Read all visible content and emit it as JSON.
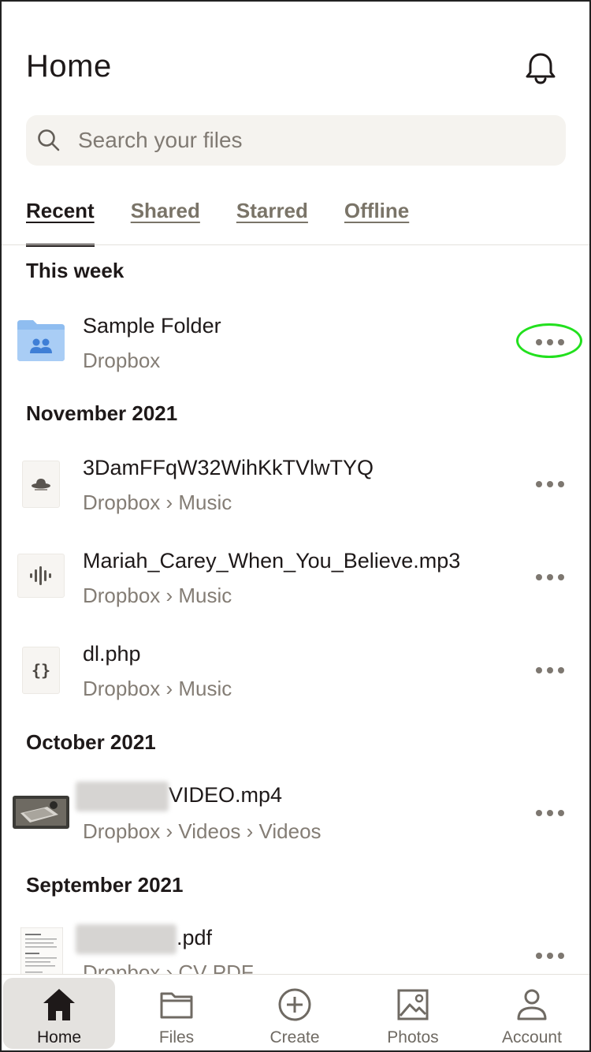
{
  "header": {
    "title": "Home",
    "notifications_icon": "bell-icon"
  },
  "search": {
    "placeholder": "Search your files",
    "icon": "search-icon"
  },
  "tabs": [
    {
      "label": "Recent",
      "active": true
    },
    {
      "label": "Shared",
      "active": false
    },
    {
      "label": "Starred",
      "active": false
    },
    {
      "label": "Offline",
      "active": false
    }
  ],
  "sections": {
    "this_week": "This week",
    "november": "November 2021",
    "october": "October 2021",
    "september": "September 2021"
  },
  "files": {
    "sample_folder": {
      "name": "Sample Folder",
      "path": "Dropbox",
      "icon": "shared-folder-icon"
    },
    "file_3dam": {
      "name": "3DamFFqW32WihKkTVlwTYQ",
      "path": "Dropbox › Music",
      "icon": "ufo-file-icon"
    },
    "mariah": {
      "name": "Mariah_Carey_When_You_Believe.mp3",
      "path": "Dropbox › Music",
      "icon": "audio-waveform-icon"
    },
    "dlphp": {
      "name": "dl.php",
      "path": "Dropbox › Music",
      "icon": "code-braces-icon"
    },
    "video": {
      "name_suffix": "VIDEO.mp4",
      "path": "Dropbox › Videos › Videos",
      "icon": "video-thumbnail"
    },
    "pdf": {
      "name_suffix": ".pdf",
      "path": "Dropbox › CV PDF",
      "icon": "pdf-thumbnail"
    }
  },
  "bottom_nav": [
    {
      "label": "Home",
      "icon": "home-icon",
      "active": true
    },
    {
      "label": "Files",
      "icon": "folder-icon",
      "active": false
    },
    {
      "label": "Create",
      "icon": "plus-circle-icon",
      "active": false
    },
    {
      "label": "Photos",
      "icon": "photo-icon",
      "active": false
    },
    {
      "label": "Account",
      "icon": "person-icon",
      "active": false
    }
  ],
  "colors": {
    "accent_highlight": "#22e01e",
    "folder_blue": "#8fbdf0",
    "text_primary": "#1e1919",
    "text_secondary": "#847d75",
    "search_bg": "#f5f3ef"
  }
}
